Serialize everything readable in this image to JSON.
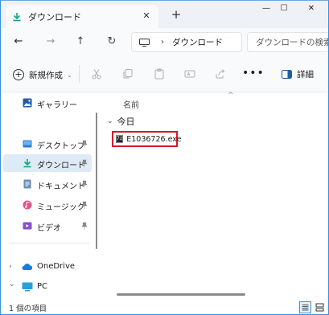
{
  "tab": {
    "title": "ダウンロード",
    "close_glyph": "✕",
    "new_tab_glyph": "+"
  },
  "window_controls": {
    "minimize": "—",
    "maximize": "☐",
    "close": "✕"
  },
  "address_bar": {
    "back": "←",
    "forward": "→",
    "up": "↑",
    "refresh": "↻",
    "separator": "›",
    "location": "ダウンロード",
    "search_placeholder": "ダウンロードの検索"
  },
  "command_bar": {
    "new_label": "新規作成",
    "more": "•••",
    "details_label": "詳細",
    "icons": [
      "cut-icon",
      "copy-icon",
      "paste-icon",
      "rename-icon",
      "share-icon",
      "delete-icon"
    ]
  },
  "sidebar": {
    "gallery": "ギャラリー",
    "quick_access": [
      {
        "label": "デスクトップ",
        "icon": "desktop-icon",
        "pinned": true
      },
      {
        "label": "ダウンロード",
        "icon": "download-icon",
        "pinned": true,
        "selected": true
      },
      {
        "label": "ドキュメント",
        "icon": "document-icon",
        "pinned": true
      },
      {
        "label": "ミュージック",
        "icon": "music-icon",
        "pinned": true
      },
      {
        "label": "ビデオ",
        "icon": "video-icon",
        "pinned": true
      }
    ],
    "onedrive": "OneDrive",
    "pc": "PC",
    "expand_right": "›",
    "expand_down": "⌄"
  },
  "content": {
    "column_header": "名前",
    "sort_caret": "^",
    "group_chevron": "⌄",
    "group_label": "今日",
    "files": [
      {
        "name": "E1036726.exe",
        "icon_text": "7z"
      }
    ]
  },
  "status_bar": {
    "item_count": "1 個の項目"
  },
  "colors": {
    "accent": "#3a8fd8",
    "selection": "#dfeaf7",
    "highlight_border": "#d9162b",
    "download_green": "#16a085"
  }
}
